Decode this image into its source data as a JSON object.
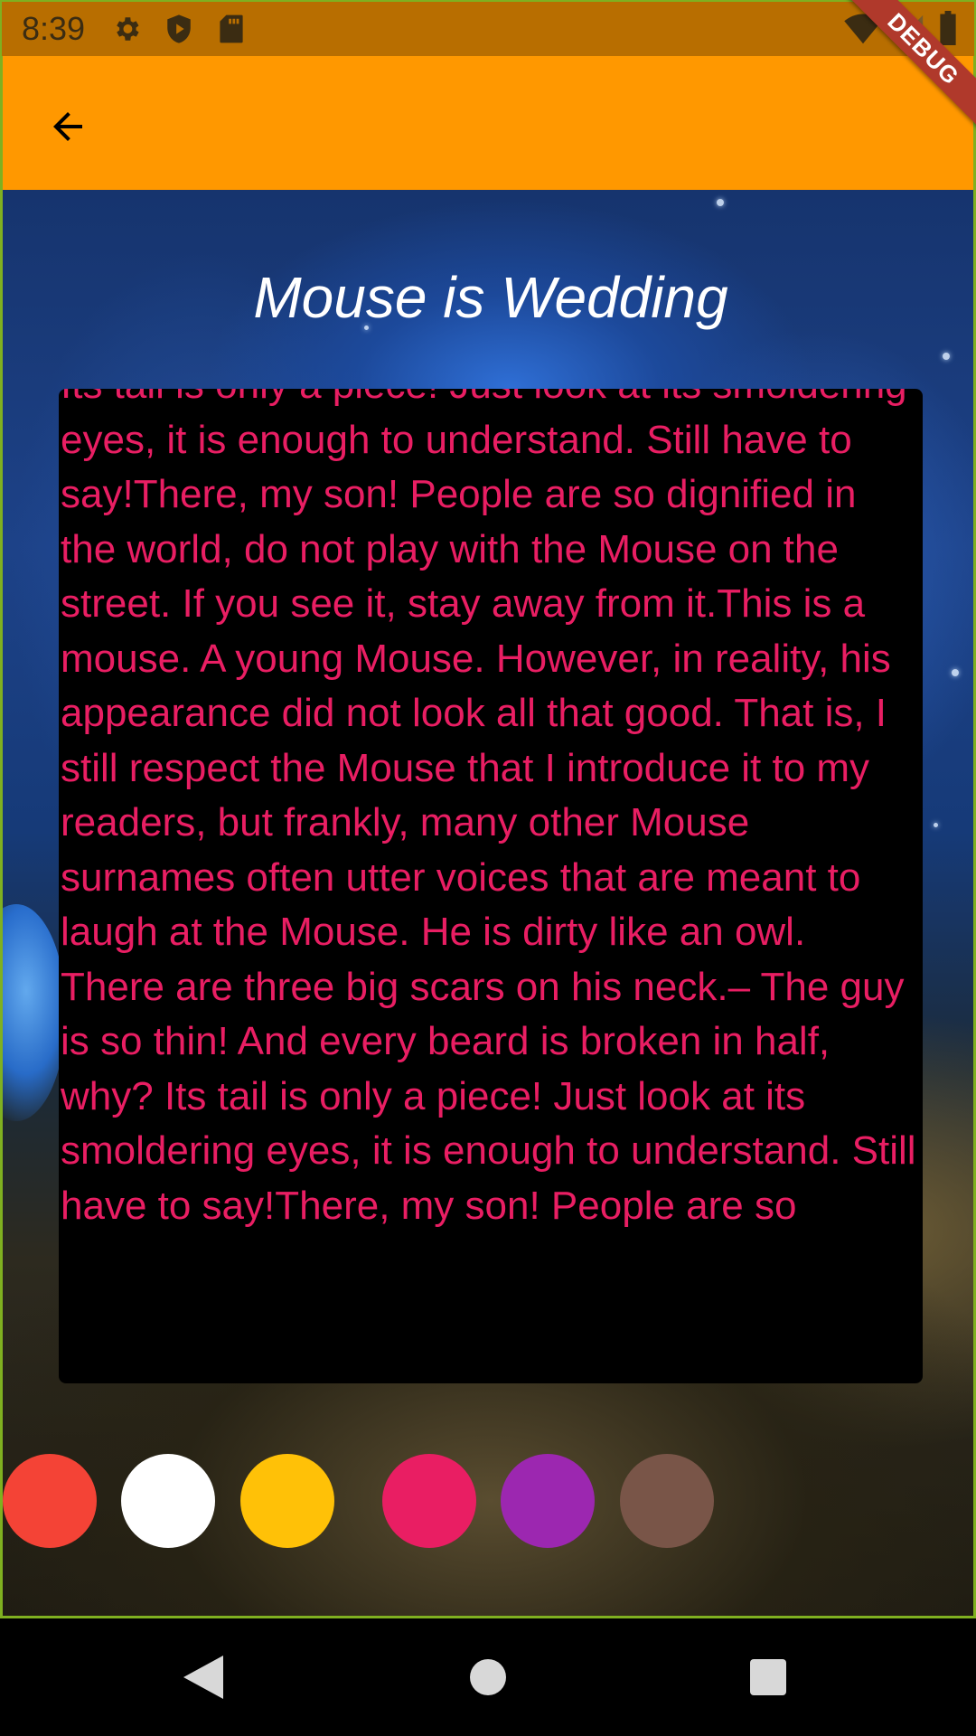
{
  "status_bar": {
    "time": "8:39",
    "left_icons": [
      "gear-icon",
      "shield-icon",
      "sd-card-icon"
    ],
    "right_icons": [
      "wifi-icon",
      "signal-icon",
      "battery-icon"
    ]
  },
  "app_bar": {
    "background_color": "#ff9800",
    "back_icon": "arrow-back-icon"
  },
  "debug_banner": {
    "label": "DEBUG"
  },
  "story": {
    "title": "Mouse is Wedding",
    "text_color": "#e91e63",
    "body": "Its tail is only a piece! Just look at its smoldering eyes, it is enough to understand. Still have to say!There, my son! People are so dignified in the world, do not play with the Mouse on the street. If you see it, stay away from it.This is a mouse. A young Mouse. However, in reality, his appearance did not look all that good. That is, I still respect the Mouse that I introduce it to my readers, but frankly, many other Mouse surnames often utter voices that are meant to laugh at the Mouse. He is dirty like an owl. There are three big scars on his neck.– The guy is so thin! And every beard is broken in half, why? Its tail is only a piece! Just look at its smoldering eyes, it is enough to understand. Still have to say!There, my son! People are so"
  },
  "color_options": [
    {
      "name": "red",
      "color": "#f44336"
    },
    {
      "name": "white",
      "color": "#ffffff"
    },
    {
      "name": "amber",
      "color": "#ffc107"
    },
    {
      "name": "pink",
      "color": "#e91e63"
    },
    {
      "name": "purple",
      "color": "#9c27b0"
    },
    {
      "name": "brown",
      "color": "#795548"
    }
  ],
  "nav_bar": {
    "buttons": [
      "back-triangle-icon",
      "home-circle-icon",
      "recents-square-icon"
    ]
  }
}
